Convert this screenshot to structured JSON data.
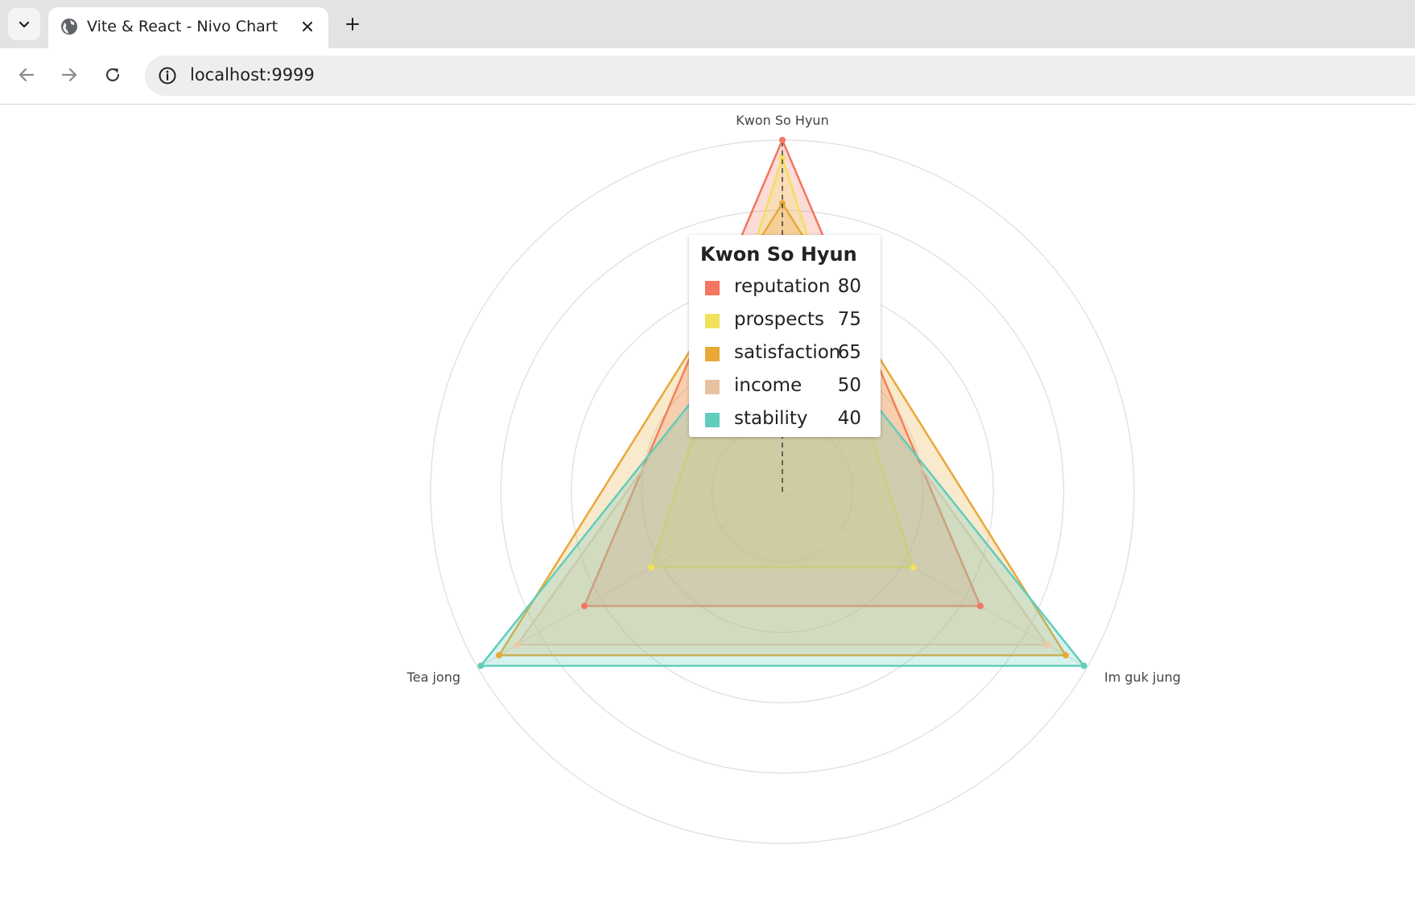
{
  "browser": {
    "tab": {
      "title": "Vite & React - Nivo Chart"
    },
    "address_bar": {
      "url": "localhost:9999"
    },
    "icons": {
      "tab_dropdown": "chevron-down-icon",
      "favicon": "globe-icon",
      "close": "close-icon",
      "new_tab": "plus-icon",
      "back": "back-arrow-icon",
      "forward": "forward-arrow-icon",
      "reload": "reload-icon",
      "site_info": "info-icon"
    }
  },
  "chart_data": {
    "type": "radar",
    "axes": [
      "Kwon So Hyun",
      "Im guk jung",
      "Tea jong"
    ],
    "max_value": 100,
    "grid_levels": 5,
    "series": [
      {
        "name": "reputation",
        "color": "#f47560",
        "values": [
          100,
          65,
          65
        ]
      },
      {
        "name": "prospects",
        "color": "#f1e15b",
        "values": [
          95,
          43,
          43
        ]
      },
      {
        "name": "satisfaction",
        "color": "#e8a838",
        "values": [
          82,
          93,
          93
        ]
      },
      {
        "name": "income",
        "color": "#f1c8a4",
        "values": [
          62,
          87,
          87
        ]
      },
      {
        "name": "stability",
        "color": "#61cdbb",
        "values": [
          58,
          99,
          99
        ]
      }
    ],
    "tooltip": {
      "title": "Kwon So Hyun",
      "rows": [
        {
          "label": "reputation",
          "value": "80",
          "color": "#f47560"
        },
        {
          "label": "prospects",
          "value": "75",
          "color": "#f1e15b"
        },
        {
          "label": "satisfaction",
          "value": "65",
          "color": "#e8a838"
        },
        {
          "label": "income",
          "value": "50",
          "color": "#e8c1a0"
        },
        {
          "label": "stability",
          "value": "40",
          "color": "#61cdbb"
        }
      ]
    }
  }
}
